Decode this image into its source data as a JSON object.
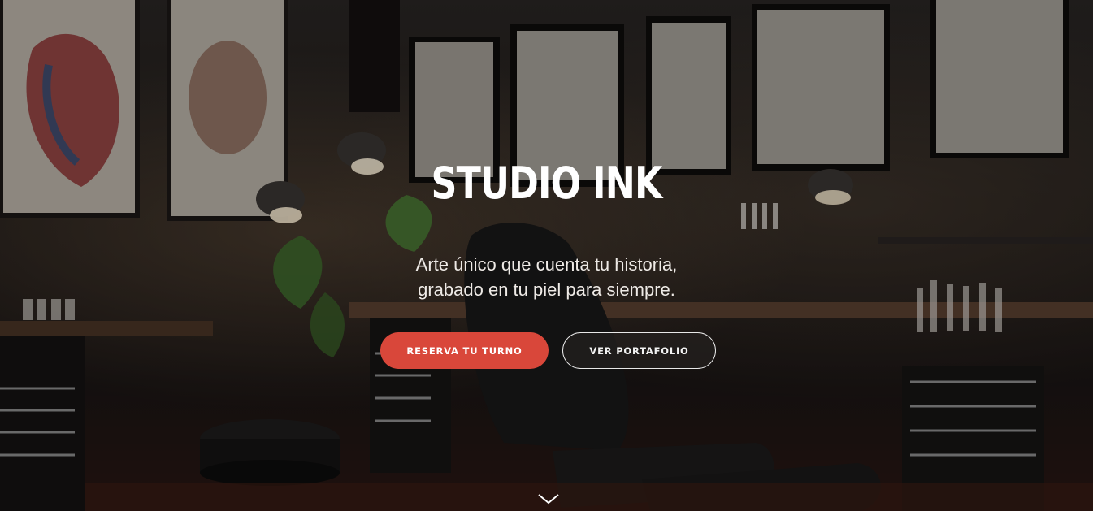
{
  "hero": {
    "title": "STUDIO INK",
    "subtitle_line1": "Arte único que cuenta tu historia,",
    "subtitle_line2": "grabado en tu piel para siempre.",
    "primary_button": "RESERVA TU TURNO",
    "secondary_button": "VER PORTAFOLIO",
    "scroll_icon": "chevron-down-icon",
    "background_image": "tattoo-studio-interior",
    "colors": {
      "accent": "#d9473a",
      "text": "#ffffff"
    }
  }
}
